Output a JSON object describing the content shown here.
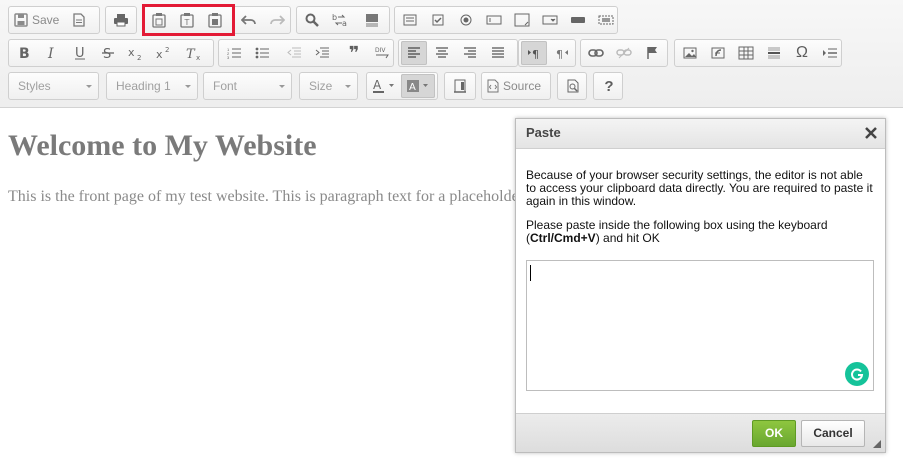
{
  "toolbar": {
    "save_label": "Save",
    "styles_label": "Styles",
    "format_label": "Heading 1",
    "font_label": "Font",
    "size_label": "Size",
    "source_label": "Source",
    "omega_symbol": "Ω",
    "quote_symbol": "❞",
    "help_symbol": "?"
  },
  "content": {
    "heading": "Welcome to My Website",
    "paragraph": "This is the front page of my test website. This is paragraph text for a placeholder"
  },
  "dialog": {
    "title": "Paste",
    "message1": "Because of your browser security settings, the editor is not able to access your clipboard data directly. You are required to paste it again in this window.",
    "message2_pre": "Please paste inside the following box using the keyboard (",
    "message2_bold": "Ctrl/Cmd+V",
    "message2_post": ") and hit OK",
    "ok_label": "OK",
    "cancel_label": "Cancel"
  },
  "colors": {
    "highlight": "#e31a35",
    "ok_green": "#7ab838",
    "grammarly": "#15c39a"
  }
}
